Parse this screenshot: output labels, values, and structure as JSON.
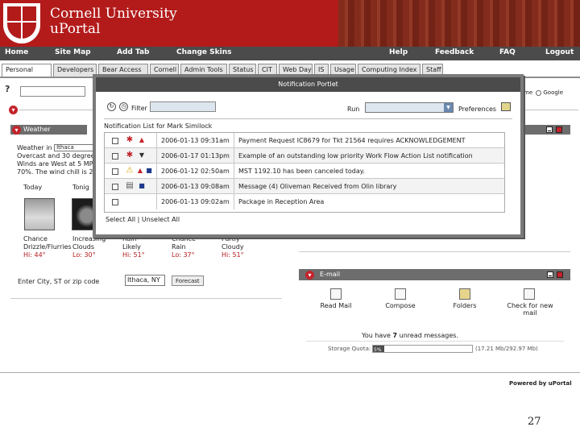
{
  "header": {
    "brand_line1": "Cornell University",
    "brand_line2": "uPortal"
  },
  "nav": {
    "items": [
      "Home",
      "Site Map",
      "Add Tab",
      "Change Skins",
      "Help",
      "Feedback",
      "FAQ",
      "Logout"
    ]
  },
  "tabs": [
    "Personal",
    "Developers",
    "Bear Access",
    "Cornell",
    "Admin Tools",
    "Status",
    "CIT",
    "Web Day",
    "IS",
    "Usage",
    "Computing Index",
    "Staff"
  ],
  "search": {
    "help_glyph": "?",
    "google_option_1": "me",
    "google_option_2": "Google"
  },
  "weather": {
    "title": "Weather",
    "weather_in_label": "Weather in",
    "city": "Ithaca",
    "line2": "Overcast and 30 degree",
    "line3": "Winds are West at 5 MP",
    "line4": "70%. The wind chill is 2",
    "col_today": "Today",
    "col_tonight": "Tonig",
    "days": [
      {
        "line1": "Chance",
        "line2": "Drizzle/Flurries",
        "temp": "Hi: 44°"
      },
      {
        "line1": "Increasing",
        "line2": "Clouds",
        "temp": "Lo: 30°"
      },
      {
        "line1": "Rain",
        "line2": "Likely",
        "temp": "Hi: 51°"
      },
      {
        "line1": "Chance",
        "line2": "Rain",
        "temp": "Lo: 37°"
      },
      {
        "line1": "Partly",
        "line2": "Cloudy",
        "temp": "Hi: 51°"
      }
    ],
    "zip_label": "Enter City, ST or zip code",
    "zip_value": "Ithaca, NY",
    "forecast_btn": "Forecast"
  },
  "email": {
    "title": "E-mail",
    "actions": [
      "Read Mail",
      "Compose",
      "Folders",
      "Check for new mail"
    ],
    "unread_prefix": "You have ",
    "unread_count": "7",
    "unread_suffix": " unread messages.",
    "quota_label": "Storage Quota:",
    "quota_pct": "5%",
    "quota_fraction": 0.05,
    "quota_text": "(17.21 Mb/292.97 Mb)"
  },
  "modal": {
    "title": "Notification Portlet",
    "filter_label": "Filter",
    "run_label": "Run",
    "prefs_label": "Preferences",
    "list_title": "Notification List for Mark Similock",
    "rows": [
      {
        "icon": "red-star",
        "priority": "high",
        "date": "2006-01-13 09:31am",
        "message": "Payment Request IC8679 for Tkt 21564 requires ACKNOWLEDGEMENT"
      },
      {
        "icon": "red-star",
        "priority": "low",
        "date": "2006-01-17 01:13pm",
        "message": "Example of an outstanding low priority Work Flow Action List notification"
      },
      {
        "icon": "warning",
        "priority": "high-both",
        "date": "2006-01-12 02:50am",
        "message": "MST 1192.10 has been canceled today."
      },
      {
        "icon": "document",
        "priority": "high",
        "date": "2006-01-13 09:08am",
        "message": "Message (4) Oliveman Received from Olin library"
      },
      {
        "icon": "none",
        "priority": "none",
        "date": "2006-01-13 09:02am",
        "message": "Package in Reception Area"
      }
    ],
    "select_all": "Select All",
    "unselect_all": "Unselect All"
  },
  "footer": {
    "powered_by": "Powered by uPortal",
    "slide_number": "27"
  },
  "colors": {
    "cornell_red": "#b31b1b",
    "nav_gray": "#4b4b4b",
    "channel_gray": "#6d6d6d"
  }
}
